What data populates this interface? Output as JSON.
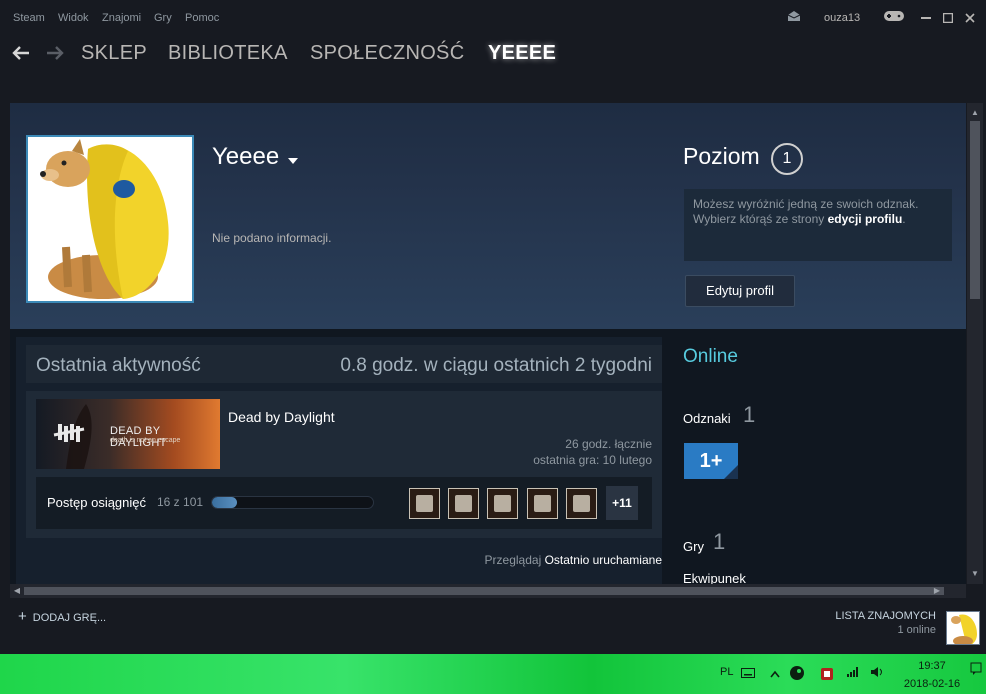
{
  "menu": {
    "items": [
      "Steam",
      "Widok",
      "Znajomi",
      "Gry",
      "Pomoc"
    ],
    "username": "ouza13"
  },
  "nav": {
    "links": [
      "SKLEP",
      "BIBLIOTEKA",
      "SPOŁECZNOŚĆ",
      "YEEEE"
    ],
    "active_index": 3
  },
  "profile": {
    "persona_name": "Yeeee",
    "summary": "Nie podano informacji.",
    "level_label": "Poziom",
    "level": "1",
    "badge_hint_text": "Możesz wyróżnić jedną ze swoich odznak. Wybierz którąś ze strony ",
    "badge_hint_link": "edycji profilu",
    "badge_hint_end": ".",
    "edit_button": "Edytuj profil"
  },
  "activity": {
    "title": "Ostatnia aktywność",
    "hours_summary": "0.8 godz. w ciągu ostatnich 2 tygodni",
    "game": {
      "name": "Dead by Daylight",
      "capsule_title": "DEAD BY DAYLIGHT",
      "capsule_subtitle": "death is not an escape",
      "total_hours": "26 godz. łącznie",
      "last_played": "ostatnia gra: 10 lutego",
      "achievements_label": "Postęp osiągnięć",
      "achievements_count": "16 z 101",
      "achievements_fraction": 0.158,
      "more_achievements": "+11"
    },
    "browse_prefix": "Przeglądaj",
    "browse_link": "Ostatnio uruchamiane"
  },
  "sidebar": {
    "status": "Online",
    "badges_label": "Odznaki",
    "badges_count": "1",
    "badge_icon_text": "1+",
    "games_label": "Gry",
    "games_count": "1",
    "inventory_label": "Ekwipunek"
  },
  "bottom": {
    "add_game": "DODAJ GRĘ...",
    "friends_label": "LISTA ZNAJOMYCH",
    "friends_online": "1 online"
  },
  "taskbar": {
    "lang": "PL",
    "time": "19:37",
    "date": "2018-02-16"
  },
  "colors": {
    "accent_online": "#57cbde",
    "background": "#171a21",
    "taskbar": "#1fd64a"
  }
}
